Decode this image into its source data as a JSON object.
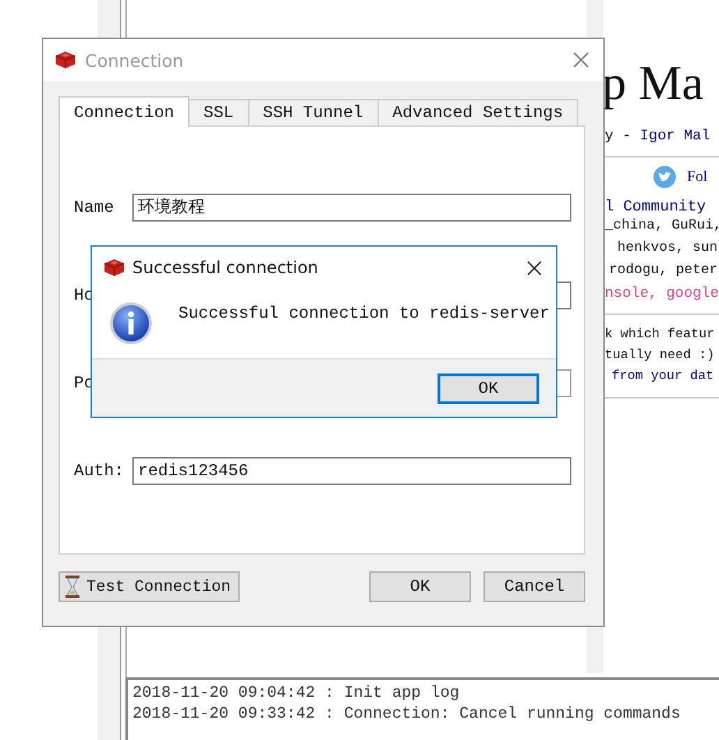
{
  "background_app": {
    "page_heading": "p Ma",
    "byline_prefix": "y - ",
    "byline_link": "Igor Mal",
    "follow_link": "Fol",
    "community_link": "l Community",
    "contributors": [
      "_china, GuRui,",
      "henkvos, sun",
      "rodogu, peter"
    ],
    "links_line": "nsole, google",
    "feature_lines": [
      "k which featur",
      "tually need :)"
    ],
    "feature_link": "from your dat"
  },
  "log": [
    "2018-11-20 09:04:42 : Init app log",
    "2018-11-20 09:33:42 : Connection: Cancel running commands"
  ],
  "connection_dialog": {
    "title": "Connection",
    "tabs": [
      {
        "label": "Connection",
        "selected": true
      },
      {
        "label": "SSL",
        "selected": false
      },
      {
        "label": "SSH Tunnel",
        "selected": false
      },
      {
        "label": "Advanced Settings",
        "selected": false
      }
    ],
    "fields": [
      {
        "label": "Name",
        "kind": "text",
        "value": "环境教程"
      },
      {
        "label": "Ho",
        "kind": "text"
      },
      {
        "label": "Po",
        "kind": "spin"
      },
      {
        "label": "Auth:",
        "kind": "text",
        "value": "redis123456"
      }
    ],
    "test_button": "Test Connection",
    "ok_button": "OK",
    "cancel_button": "Cancel"
  },
  "message_box": {
    "title": "Successful connection",
    "message": "Successful connection to redis-server",
    "ok_button": "OK"
  }
}
